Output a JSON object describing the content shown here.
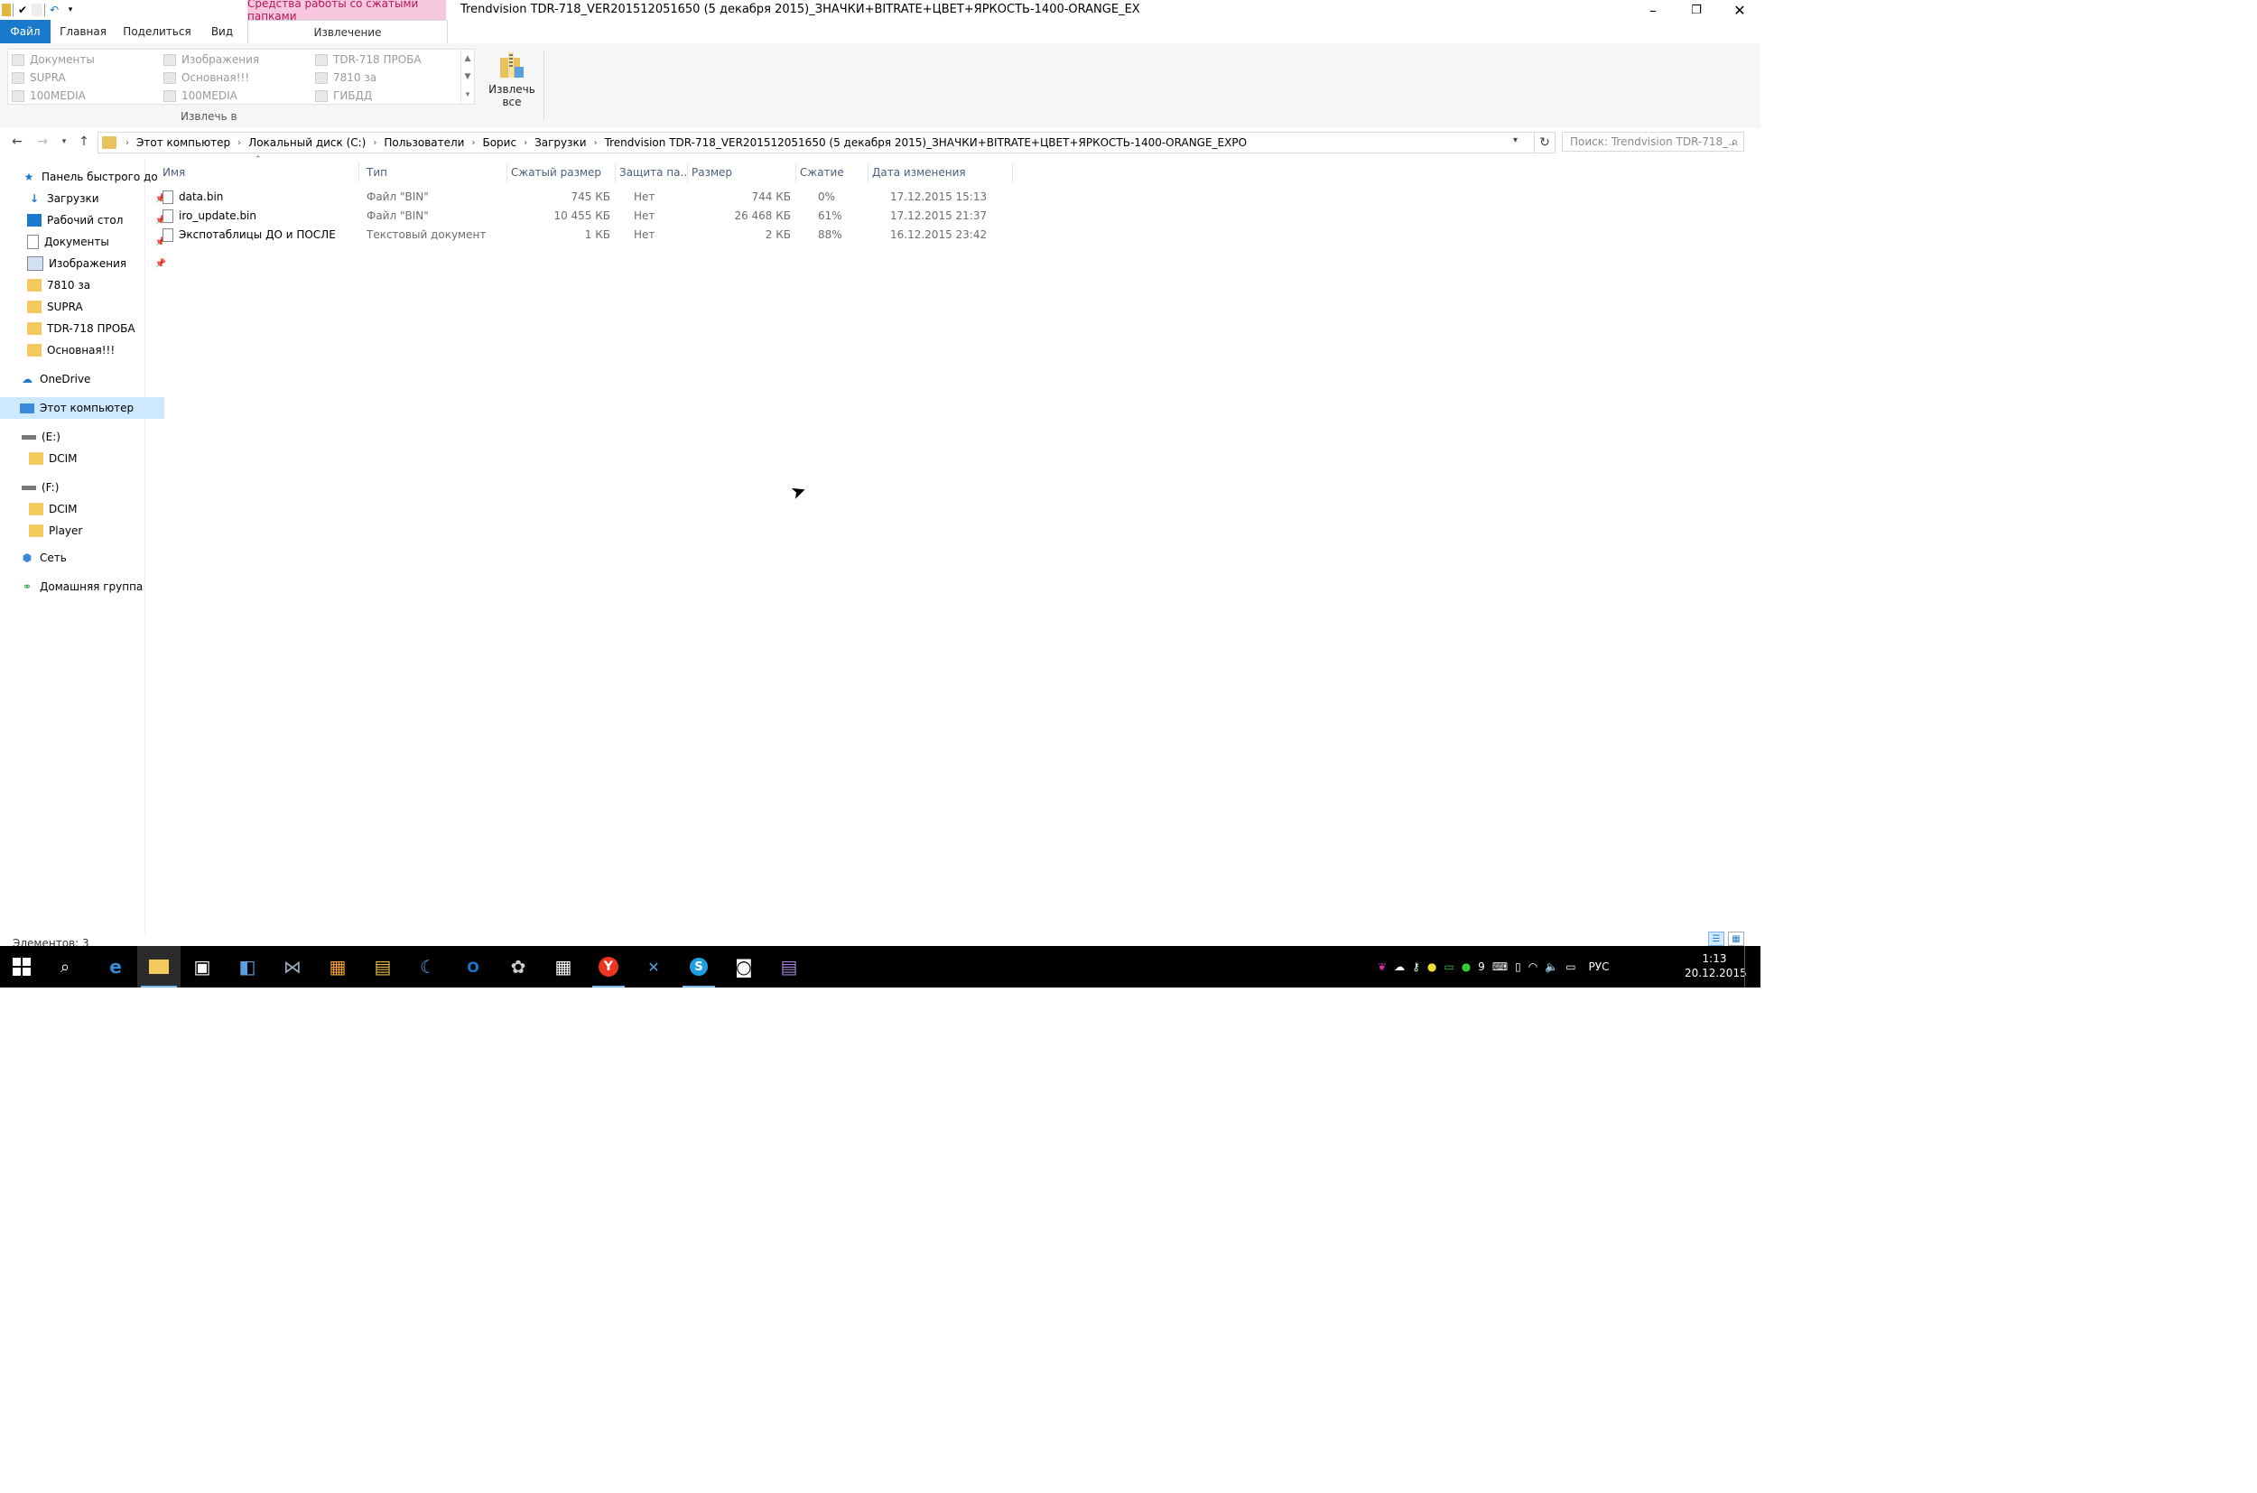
{
  "window": {
    "title": "Trendvision TDR-718_VER201512051650 (5 декабря 2015)_ЗНАЧКИ+BITRATE+ЦВЕТ+ЯРКОСТЬ-1400-ORANGE_EX",
    "context_tab": "Средства работы со сжатыми папками"
  },
  "ribbon": {
    "tabs": [
      "Файл",
      "Главная",
      "Поделиться",
      "Вид",
      "Извлечение"
    ],
    "gallery": [
      [
        "Документы",
        "Изображения",
        "TDR-718 ПРОБА"
      ],
      [
        "SUPRA",
        "Основная!!!",
        "7810 за"
      ],
      [
        "100MEDIA",
        "100MEDIA",
        "ГИБДД"
      ]
    ],
    "group_label": "Извлечь в",
    "extract_all_line1": "Извлечь",
    "extract_all_line2": "все"
  },
  "address": {
    "crumbs": [
      "Этот компьютер",
      "Локальный диск (C:)",
      "Пользователи",
      "Борис",
      "Загрузки",
      "Trendvision TDR-718_VER201512051650 (5 декабря 2015)_ЗНАЧКИ+BITRATE+ЦВЕТ+ЯРКОСТЬ-1400-ORANGE_EXPO"
    ],
    "search_placeholder": "Поиск: Trendvision TDR-718_..."
  },
  "nav": {
    "quick_access": "Панель быстрого до",
    "items": [
      "Загрузки",
      "Рабочий стол",
      "Документы",
      "Изображения",
      "7810 за",
      "SUPRA",
      "TDR-718 ПРОБА",
      "Основная!!!"
    ],
    "onedrive": "OneDrive",
    "this_pc": "Этот компьютер",
    "drive_e": "(E:)",
    "drive_e_folder": "DCIM",
    "drive_f": "(F:)",
    "drive_f_folders": [
      "DCIM",
      "Player"
    ],
    "network": "Сеть",
    "homegroup": "Домашняя группа"
  },
  "columns": [
    "Имя",
    "Тип",
    "Сжатый размер",
    "Защита па...",
    "Размер",
    "Сжатие",
    "Дата изменения"
  ],
  "files": [
    {
      "name": "data.bin",
      "type": "Файл \"BIN\"",
      "packed": "745 КБ",
      "protected": "Нет",
      "size": "744 КБ",
      "ratio": "0%",
      "date": "17.12.2015 15:13"
    },
    {
      "name": "iro_update.bin",
      "type": "Файл \"BIN\"",
      "packed": "10 455 КБ",
      "protected": "Нет",
      "size": "26 468 КБ",
      "ratio": "61%",
      "date": "17.12.2015 21:37"
    },
    {
      "name": "Экспотаблицы ДО и ПОСЛЕ",
      "type": "Текстовый документ",
      "packed": "1 КБ",
      "protected": "Нет",
      "size": "2 КБ",
      "ratio": "88%",
      "date": "16.12.2015 23:42"
    }
  ],
  "status": {
    "items": "Элементов: 3"
  },
  "taskbar": {
    "tray_number": "9",
    "lang": "РУС",
    "time": "1:13",
    "date": "20.12.2015"
  },
  "colors": {
    "accent": "#1979ca",
    "context": "#f7c8dd",
    "selection": "#cde8ff",
    "folder": "#f2ca5d"
  }
}
